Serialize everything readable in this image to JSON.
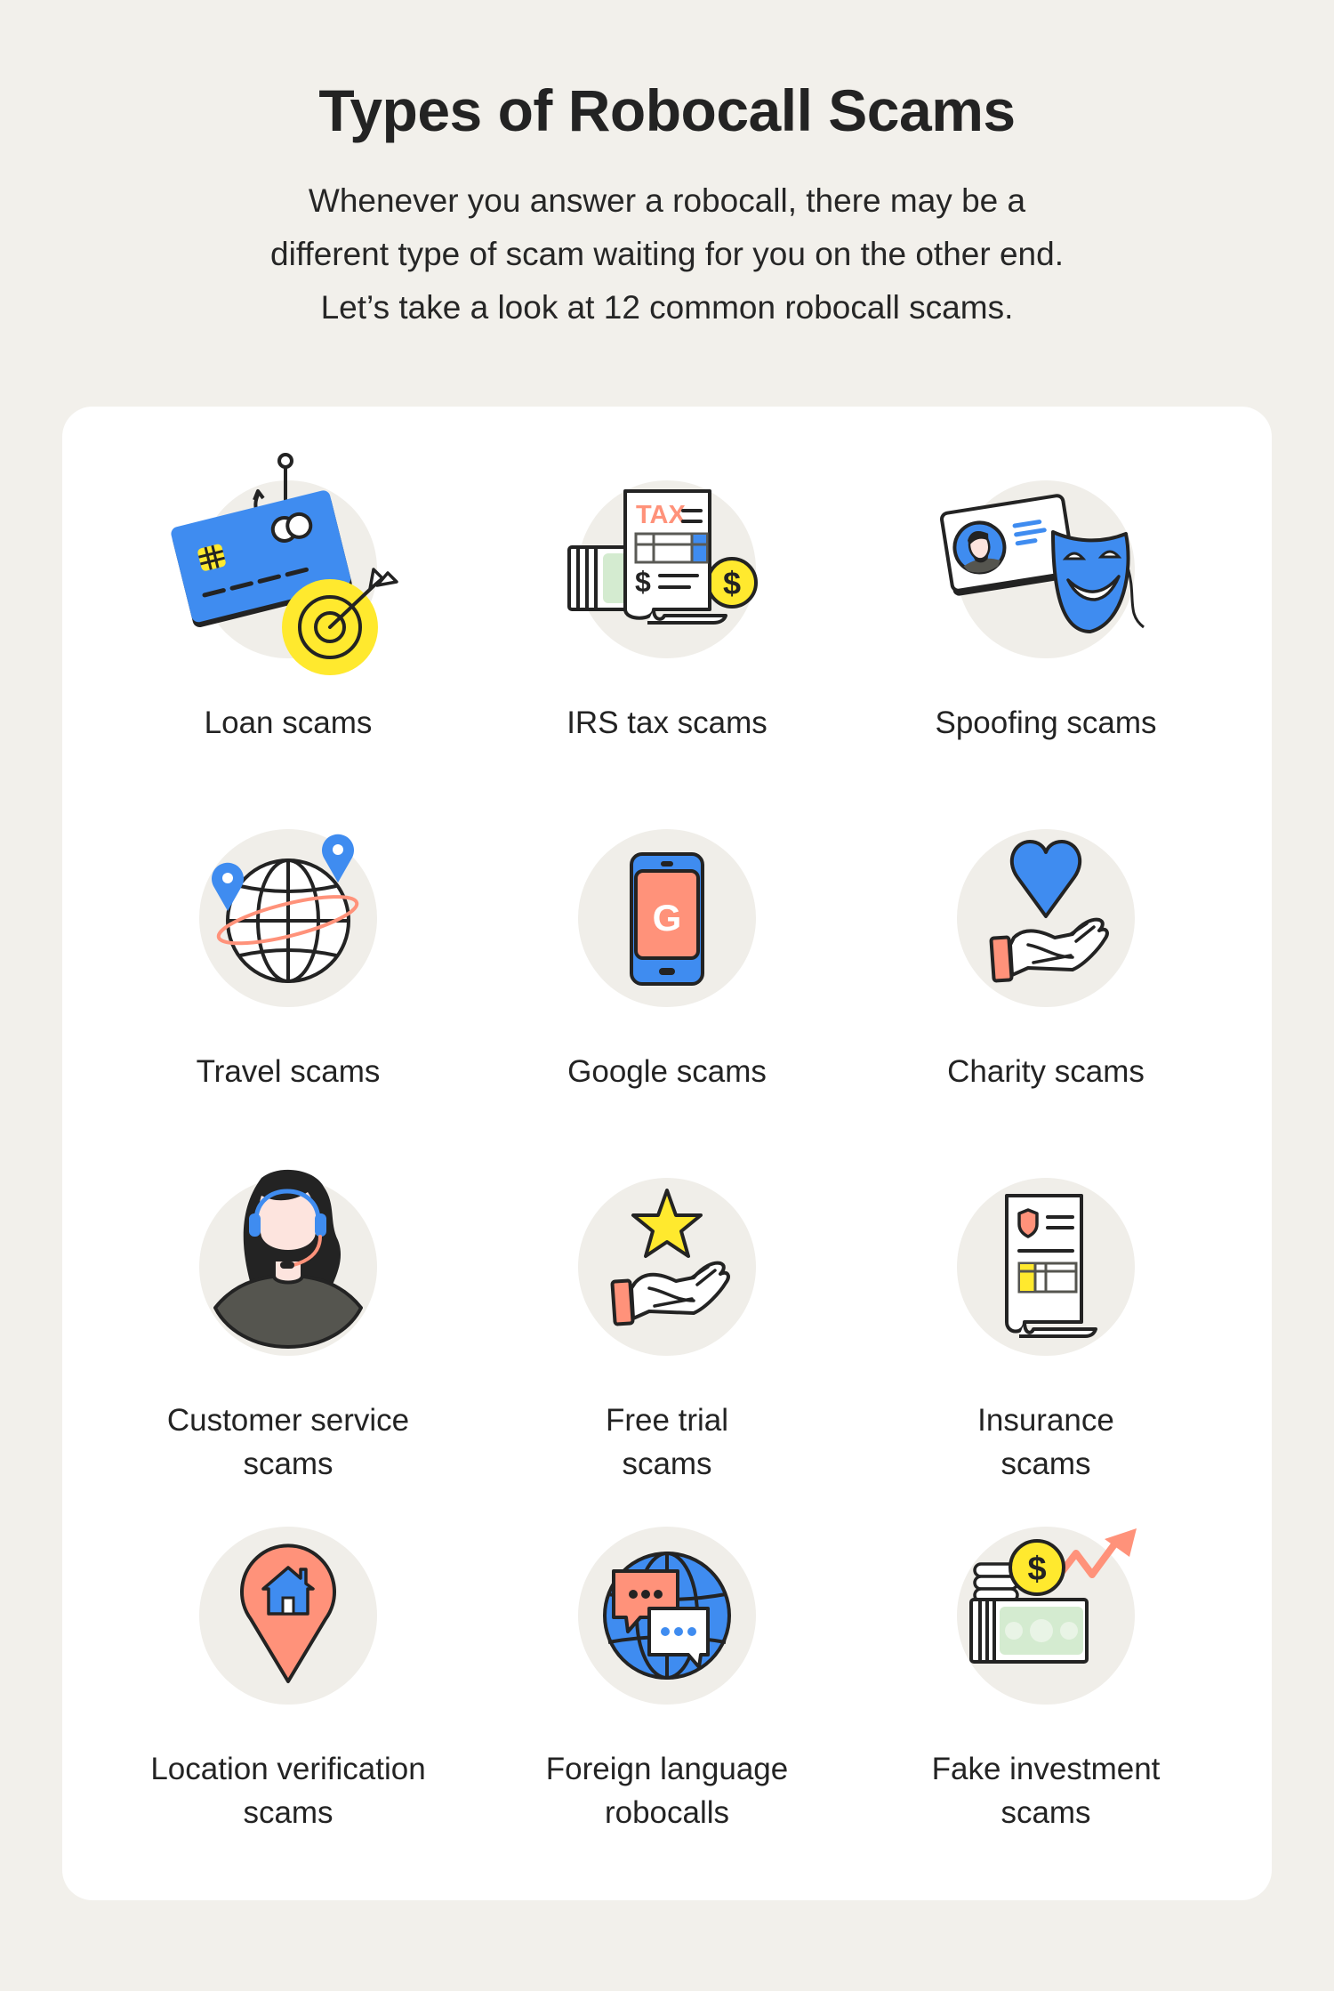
{
  "header": {
    "title": "Types of Robocall Scams",
    "subtitle_lines": [
      "Whenever you answer a robocall, there may be a",
      "different type of scam waiting for you on the other end.",
      "Let’s take a look at 12 common robocall scams."
    ]
  },
  "colors": {
    "page_background": "#f2f0eb",
    "card_background": "#ffffff",
    "icon_circle": "#f0eee9",
    "blue": "#3f8cf0",
    "coral": "#ff927a",
    "yellow": "#ffe92e",
    "green": "#d4ebd0",
    "outline": "#232323"
  },
  "scams": [
    {
      "icon": "credit-card-hook-target-icon",
      "label_lines": [
        "Loan scams"
      ]
    },
    {
      "icon": "tax-document-money-icon",
      "label_lines": [
        "IRS tax scams"
      ]
    },
    {
      "icon": "id-card-mask-icon",
      "label_lines": [
        "Spoofing scams"
      ]
    },
    {
      "icon": "globe-location-pins-icon",
      "label_lines": [
        "Travel scams"
      ]
    },
    {
      "icon": "phone-google-icon",
      "label_lines": [
        "Google scams"
      ]
    },
    {
      "icon": "hand-heart-icon",
      "label_lines": [
        "Charity scams"
      ]
    },
    {
      "icon": "headset-agent-icon",
      "label_lines": [
        "Customer service",
        "scams"
      ]
    },
    {
      "icon": "hand-star-icon",
      "label_lines": [
        "Free trial",
        "scams"
      ]
    },
    {
      "icon": "insurance-document-icon",
      "label_lines": [
        "Insurance",
        "scams"
      ]
    },
    {
      "icon": "location-pin-house-icon",
      "label_lines": [
        "Location verification",
        "scams"
      ]
    },
    {
      "icon": "globe-chat-bubbles-icon",
      "label_lines": [
        "Foreign language",
        "robocalls"
      ]
    },
    {
      "icon": "coins-cash-growth-icon",
      "label_lines": [
        "Fake investment",
        "scams"
      ]
    }
  ]
}
